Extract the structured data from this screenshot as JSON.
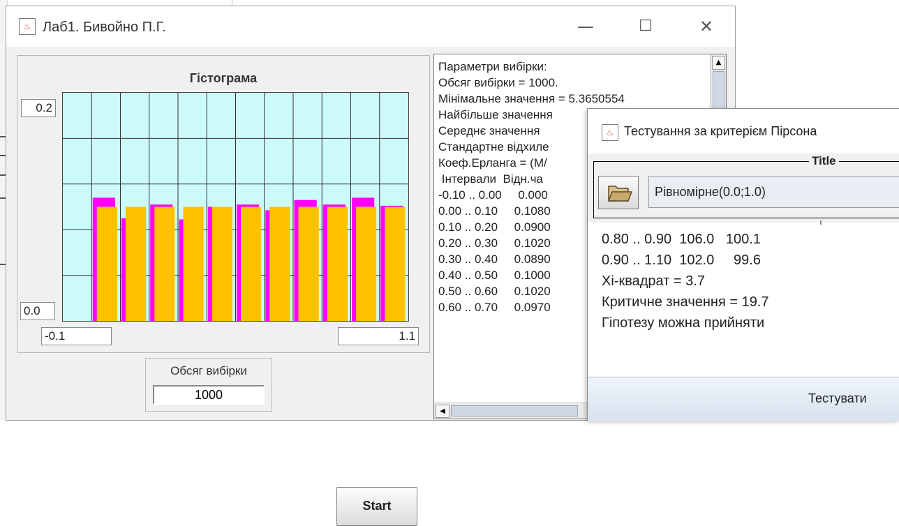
{
  "main_window": {
    "title": "Лаб1. Бивойно П.Г.",
    "app_icon": "java-cup-icon",
    "controls": {
      "minimize": "—",
      "maximize": "☐",
      "close": "✕"
    }
  },
  "histogram": {
    "title": "Гістограма",
    "y_max_label": "0.2",
    "y_min_label": "0.0",
    "x_min_label": "-0.1",
    "x_max_label": "1.1",
    "colors": {
      "plot_bg": "#ccfafa",
      "grid": "#333333",
      "theory": "#ff00ff",
      "empirical": "#ffc000"
    }
  },
  "chart_data": {
    "type": "bar",
    "title": "Гістограма",
    "xlim": [
      -0.1,
      1.1
    ],
    "ylim": [
      0.0,
      0.2
    ],
    "grid": true,
    "series": [
      {
        "name": "",
        "color": "#ff00ff",
        "values": [
          0.0,
          0.108,
          0.09,
          0.102,
          0.089,
          0.1,
          0.102,
          0.097,
          0.106,
          0.102,
          0.108,
          0.101
        ]
      },
      {
        "name": "",
        "color": "#ffc000",
        "values": [
          0.0,
          0.1,
          0.1,
          0.1,
          0.1,
          0.1,
          0.1,
          0.1,
          0.1,
          0.1,
          0.1,
          0.1
        ]
      }
    ]
  },
  "sample": {
    "label": "Обсяг вибірки",
    "value": "1000"
  },
  "start_button": "Start",
  "output_text": {
    "lines": [
      "Параметри вибірки:",
      "Обсяг вибірки = 1000.",
      "Мінімальне значення = 5.3650554",
      "Найбільше значення",
      "Середнє значення",
      "Стандартне відхиле",
      "Коеф.Ерланга = (М/",
      " Інтервали  Відн.ча",
      "-0.10 .. 0.00     0.000",
      "0.00 .. 0.10     0.1080",
      "0.10 .. 0.20     0.0900",
      "0.20 .. 0.30     0.1020",
      "0.30 .. 0.40     0.0890",
      "0.40 .. 0.50     0.1000",
      "0.50 .. 0.60     0.1020",
      "0.60 .. 0.70     0.0970"
    ]
  },
  "dialog": {
    "title": "Тестування за критерієм Пірсона",
    "group_title": "Title",
    "distribution": "Рівномірне(0.0;1.0)",
    "results": [
      "0.80 .. 0.90  106.0   100.1",
      "0.90 .. 1.10  102.0     99.6",
      "Хі-квадрат = 3.7",
      "Критичне значення = 19.7",
      "Гіпотезу можна прийняти"
    ],
    "test_button": "Тестувати"
  }
}
